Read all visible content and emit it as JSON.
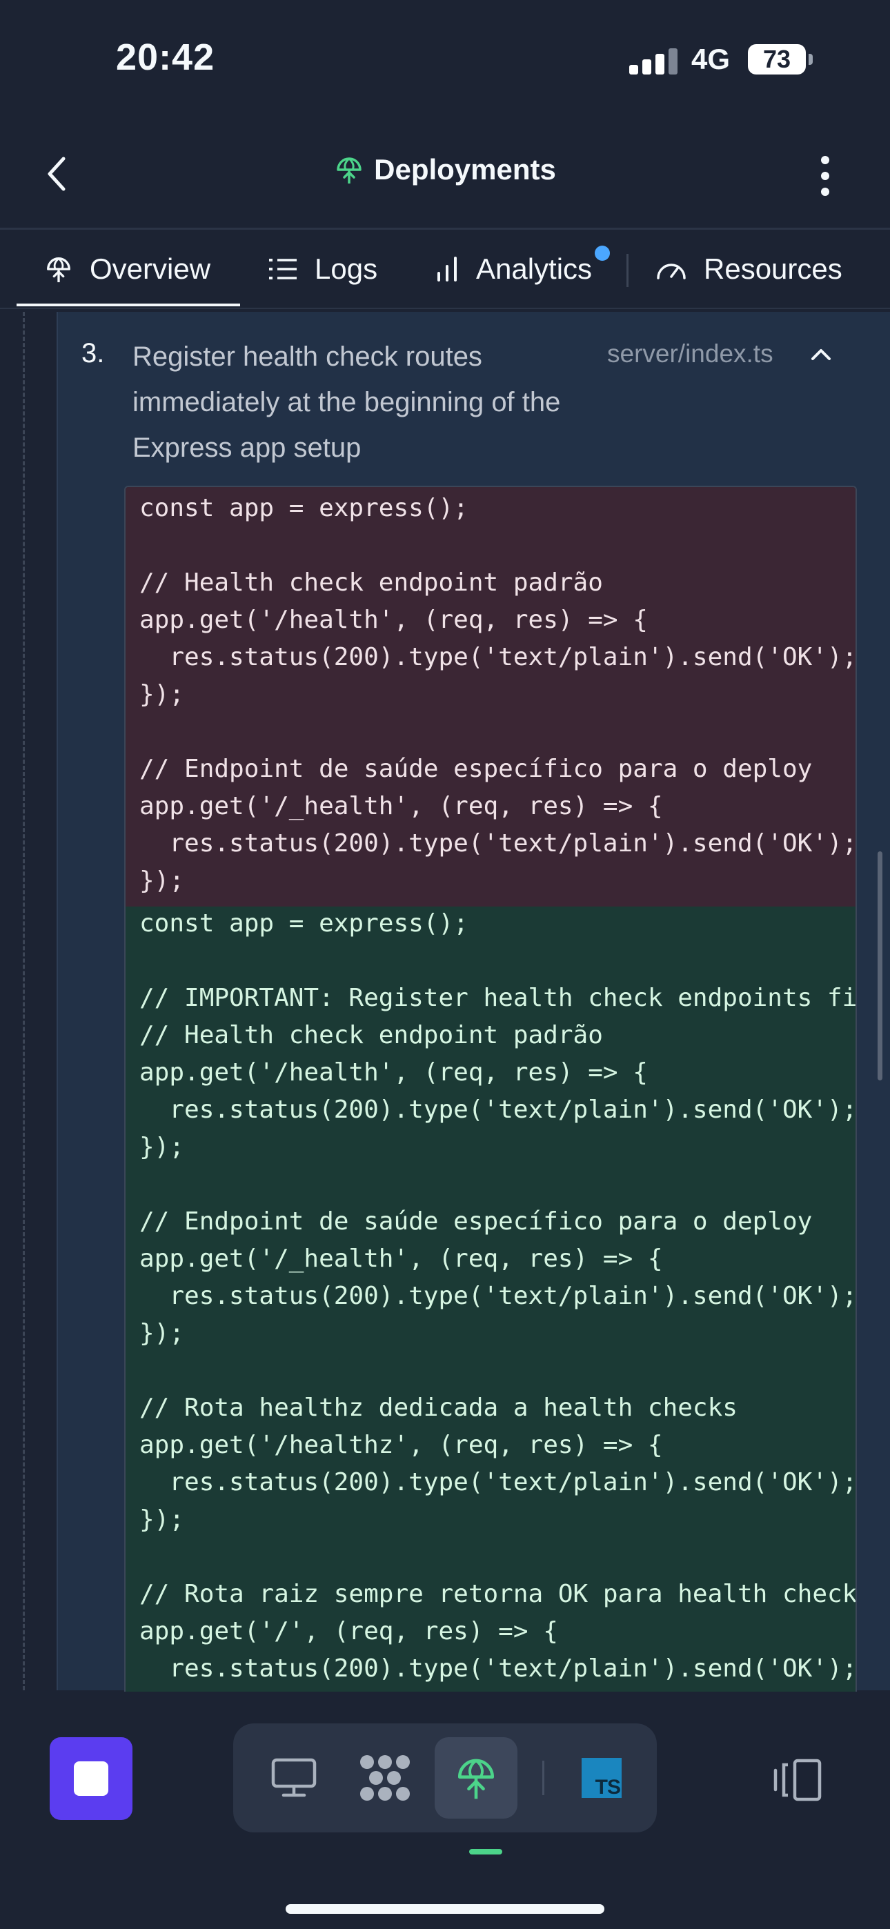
{
  "status_bar": {
    "time": "20:42",
    "network": "4G",
    "battery": "73"
  },
  "header": {
    "title": "Deployments"
  },
  "tabs": [
    {
      "label": "Overview",
      "icon": "deploy-icon",
      "active": true
    },
    {
      "label": "Logs",
      "icon": "list-icon",
      "active": false
    },
    {
      "label": "Analytics",
      "icon": "bar-chart-icon",
      "active": false,
      "has_notification": true
    },
    {
      "label": "Resources",
      "icon": "gauge-icon",
      "active": false
    }
  ],
  "step": {
    "number": "3.",
    "text": "Register health check routes immediately at the beginning of the Express app setup",
    "file": "server/index.ts"
  },
  "diff": {
    "removed": [
      "const app = express();",
      "",
      "// Health check endpoint padrão",
      "app.get('/health', (req, res) => {",
      "  res.status(200).type('text/plain').send('OK');",
      "});",
      "",
      "// Endpoint de saúde específico para o deploy",
      "app.get('/_health', (req, res) => {",
      "  res.status(200).type('text/plain').send('OK');",
      "});"
    ],
    "added": [
      "const app = express();",
      "",
      "// IMPORTANT: Register health check endpoints fi",
      "// Health check endpoint padrão",
      "app.get('/health', (req, res) => {",
      "  res.status(200).type('text/plain').send('OK');",
      "});",
      "",
      "// Endpoint de saúde específico para o deploy",
      "app.get('/_health', (req, res) => {",
      "  res.status(200).type('text/plain').send('OK');",
      "});",
      "",
      "// Rota healthz dedicada a health checks",
      "app.get('/healthz', (req, res) => {",
      "  res.status(200).type('text/plain').send('OK');",
      "});",
      "",
      "// Rota raiz sempre retorna OK para health check",
      "app.get('/', (req, res) => {",
      "  res.status(200).type('text/plain').send('OK');"
    ]
  },
  "dock": {
    "items": [
      "monitor-icon",
      "workflow-icon",
      "deploy-icon",
      "typescript-file-icon"
    ],
    "active": "deploy-icon",
    "ts_label": "TS"
  },
  "colors": {
    "background": "#1c2333",
    "removed_bg": "#3b2634",
    "added_bg": "#1b3a35",
    "accent_green": "#4cd48a",
    "stop_purple": "#5b3df0",
    "notification_blue": "#4ba7ff"
  }
}
